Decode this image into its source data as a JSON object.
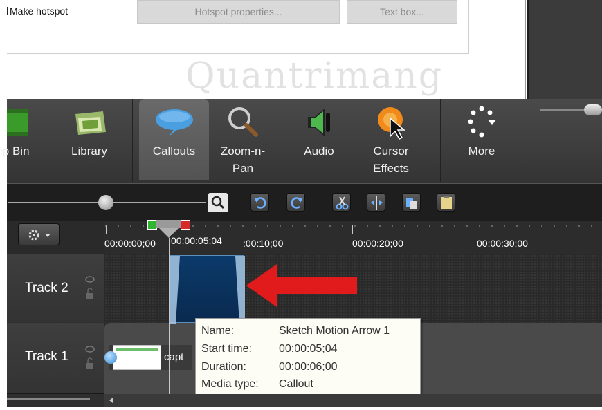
{
  "properties_panel": {
    "make_hotspot_label": "Make hotspot",
    "hotspot_properties_button": "Hotspot properties...",
    "text_box_button": "Text box...",
    "watermark": "Quantrimang"
  },
  "toolbar": {
    "items": [
      {
        "label": "ip Bin",
        "icon": "clip-bin-icon"
      },
      {
        "label": "Library",
        "icon": "library-icon"
      },
      {
        "label": "Callouts",
        "icon": "speech-bubble-icon"
      },
      {
        "label": "Zoom-n-Pan",
        "line1": "Zoom-n-",
        "line2": "Pan",
        "icon": "magnifier-icon"
      },
      {
        "label": "Audio",
        "icon": "speaker-icon"
      },
      {
        "label": "Cursor Effects",
        "line1": "Cursor",
        "line2": "Effects",
        "icon": "cursor-effect-icon"
      },
      {
        "label": "More",
        "icon": "more-dots-icon"
      }
    ],
    "selected": "Callouts"
  },
  "timeline": {
    "ruler_labels": [
      "00:00:00;00",
      "00:00:05;04",
      ":00:10;00",
      "00:00:20;00",
      "00:00:30;00"
    ],
    "tracks": [
      "Track 2",
      "Track 1"
    ],
    "track1_clip_label": "capt"
  },
  "tooltip": {
    "rows": [
      {
        "key": "Name:",
        "value": "Sketch Motion Arrow 1"
      },
      {
        "key": "Start time:",
        "value": "00:00:05;04"
      },
      {
        "key": "Duration:",
        "value": "00:00:06;00"
      },
      {
        "key": "Media type:",
        "value": "Callout"
      }
    ]
  },
  "colors": {
    "arrow_red": "#e11b1b",
    "clip_blue": "#0e3a66",
    "toolbar_dark": "#3c3c3c"
  }
}
